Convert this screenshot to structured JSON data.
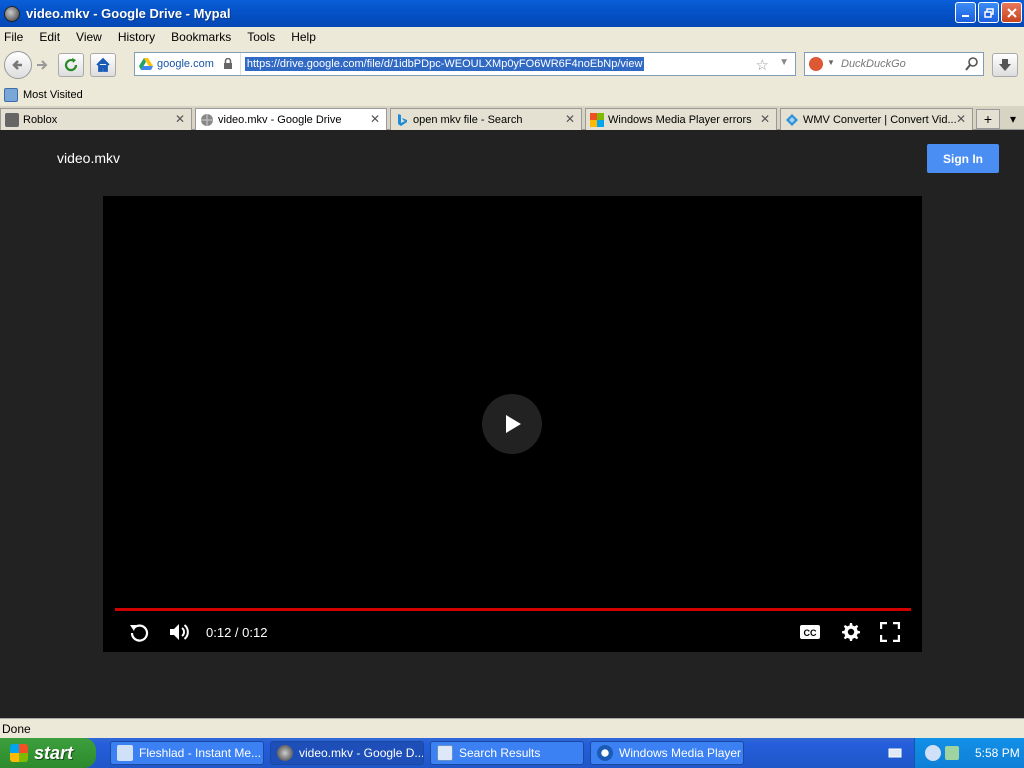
{
  "window": {
    "title": "video.mkv - Google Drive - Mypal"
  },
  "menu": [
    "File",
    "Edit",
    "View",
    "History",
    "Bookmarks",
    "Tools",
    "Help"
  ],
  "navbar": {
    "site_identity": "google.com",
    "url": "https://drive.google.com/file/d/1idbPDpc-WEOULXMp0yFO6WR6F4noEbNp/view",
    "search_placeholder": "DuckDuckGo"
  },
  "bookmarks": {
    "most_visited": "Most Visited"
  },
  "tabs": [
    {
      "label": "Roblox"
    },
    {
      "label": "video.mkv - Google Drive"
    },
    {
      "label": "open mkv file - Search"
    },
    {
      "label": "Windows Media Player errors"
    },
    {
      "label": "WMV Converter | Convert Vid..."
    }
  ],
  "page": {
    "filename": "video.mkv",
    "signin_label": "Sign In",
    "player": {
      "time": "0:12 / 0:12",
      "progress": 1.0
    }
  },
  "status": {
    "text": "Done"
  },
  "taskbar": {
    "start_label": "start",
    "tasks": [
      {
        "label": "Fleshlad - Instant Me..."
      },
      {
        "label": "video.mkv - Google D..."
      },
      {
        "label": "Search Results"
      },
      {
        "label": "Windows Media Player"
      }
    ],
    "clock": "5:58 PM"
  },
  "colors": {
    "progress": "#d10000",
    "signin": "#4a8df3",
    "page_bg": "#222222"
  }
}
